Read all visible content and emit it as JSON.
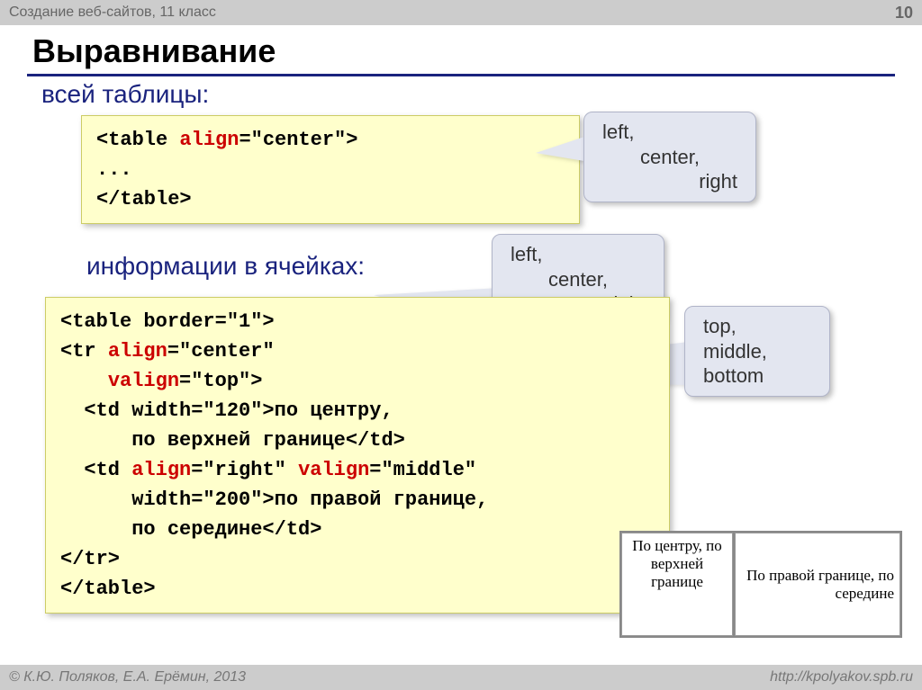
{
  "header": {
    "course": "Создание веб-сайтов, 11 класс",
    "page_number": "10"
  },
  "title": "Выравнивание",
  "section1": {
    "heading": "всей таблицы:",
    "code": {
      "l1_pre": "<table ",
      "l1_attr": "align",
      "l1_post": "=\"center\">",
      "l2": "...",
      "l3": "</table>"
    }
  },
  "section2": {
    "heading": "информации в ячейках:",
    "code": {
      "l1": "<table border=\"1\">",
      "l2_pre": "<tr ",
      "l2_attr": "align",
      "l2_post": "=\"center\"",
      "l3_pre": "    ",
      "l3_attr": "valign",
      "l3_post": "=\"top\">",
      "l4": "  <td width=\"120\">по центру,",
      "l5": "      по верхней границе</td>",
      "l6_a": "  <td ",
      "l6_attr1": "align",
      "l6_b": "=\"right\" ",
      "l6_attr2": "valign",
      "l6_c": "=\"middle\"",
      "l7": "      width=\"200\">по правой границе,",
      "l8": "      по середине</td>",
      "l9": "</tr>",
      "l10": "</table>"
    }
  },
  "callouts": {
    "align": {
      "v1": "left,",
      "v2": "center,",
      "v3": "right"
    },
    "valign": {
      "v1": "top,",
      "v2": "middle,",
      "v3": "bottom"
    }
  },
  "example": {
    "cell1": "По центру, по верхней границе",
    "cell2": "По правой границе, по середине"
  },
  "footer": {
    "copyright": "© К.Ю. Поляков, Е.А. Ерёмин, 2013",
    "url": "http://kpolyakov.spb.ru"
  }
}
